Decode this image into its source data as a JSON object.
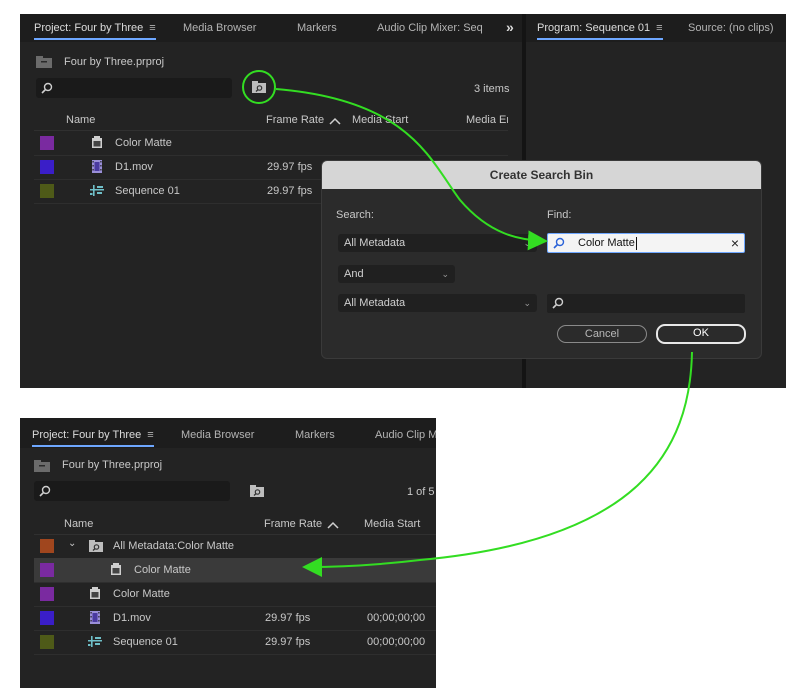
{
  "top_panel": {
    "tabs": [
      "Project: Four by Three",
      "Media Browser",
      "Markers",
      "Audio Clip Mixer: Seq"
    ],
    "hamburger": "≡",
    "overflow": "»",
    "program_tab": "Program: Sequence 01",
    "source_tab": "Source: (no clips)",
    "project_file": "Four by Three.prproj",
    "item_count": "3 items",
    "columns": [
      "Name",
      "Frame Rate",
      "Media Start",
      "Media En"
    ],
    "rows": [
      {
        "name": "Color Matte",
        "frame_rate": "",
        "color": "#7a2aa0"
      },
      {
        "name": "D1.mov",
        "frame_rate": "29.97 fps",
        "color": "#3a1ec8"
      },
      {
        "name": "Sequence 01",
        "frame_rate": "29.97 fps",
        "color": "#4e5a18"
      }
    ]
  },
  "dialog": {
    "title": "Create Search Bin",
    "search_label": "Search:",
    "find_label": "Find:",
    "search1": "All Metadata",
    "find1_value": "Color Matte",
    "operator": "And",
    "search2": "All Metadata",
    "find2_value": "",
    "cancel": "Cancel",
    "ok": "OK"
  },
  "bottom_panel": {
    "tabs": [
      "Project: Four by Three",
      "Media Browser",
      "Markers",
      "Audio Clip M"
    ],
    "hamburger": "≡",
    "project_file": "Four by Three.prproj",
    "item_count": "1 of 5",
    "columns": [
      "Name",
      "Frame Rate",
      "Media Start"
    ],
    "search_bin": {
      "name": "All Metadata:Color Matte",
      "color": "#a0461e"
    },
    "search_bin_child": {
      "name": "Color Matte",
      "color": "#7a2aa0"
    },
    "rows": [
      {
        "name": "Color Matte",
        "frame_rate": "",
        "media_start": "",
        "color": "#7a2aa0"
      },
      {
        "name": "D1.mov",
        "frame_rate": "29.97 fps",
        "media_start": "00;00;00;00",
        "color": "#3a1ec8"
      },
      {
        "name": "Sequence 01",
        "frame_rate": "29.97 fps",
        "media_start": "00;00;00;00",
        "color": "#4e5a18"
      }
    ]
  },
  "colors": {
    "annotation": "#33dd22",
    "accent": "#6ea7ff"
  },
  "icons": [
    "folder-up-icon",
    "search-icon",
    "new-search-bin-icon",
    "color-matte-icon",
    "movie-clip-icon",
    "sequence-icon",
    "clear-x-icon",
    "chevron-down-icon",
    "sort-ascending-icon"
  ]
}
